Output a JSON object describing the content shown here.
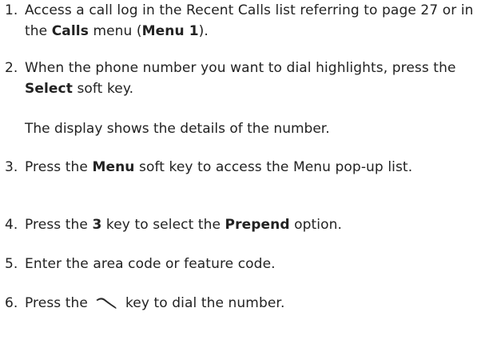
{
  "steps": [
    {
      "number": "1.",
      "parts": [
        {
          "text": "Access a call log in the Recent Calls list referring to page 27 or in the ",
          "bold": false
        },
        {
          "text": "Calls",
          "bold": true
        },
        {
          "text": " menu (",
          "bold": false
        },
        {
          "text": "Menu 1",
          "bold": true
        },
        {
          "text": ").",
          "bold": false
        }
      ]
    },
    {
      "number": "2.",
      "parts": [
        {
          "text": "When the phone number you want to dial highlights, press the ",
          "bold": false
        },
        {
          "text": "Select",
          "bold": true
        },
        {
          "text": " soft key.",
          "bold": false
        }
      ]
    },
    {
      "number": "3.",
      "parts": [
        {
          "text": "Press the ",
          "bold": false
        },
        {
          "text": "Menu",
          "bold": true
        },
        {
          "text": " soft key to access the Menu pop-up list.",
          "bold": false
        }
      ]
    },
    {
      "number": "4.",
      "parts": [
        {
          "text": "Press the ",
          "bold": false
        },
        {
          "text": "3",
          "bold": true
        },
        {
          "text": " key to select the ",
          "bold": false
        },
        {
          "text": "Prepend",
          "bold": true
        },
        {
          "text": " option.",
          "bold": false
        }
      ]
    },
    {
      "number": "5.",
      "parts": [
        {
          "text": "Enter the area code or feature code.",
          "bold": false
        }
      ]
    },
    {
      "number": "6.",
      "parts": [
        {
          "text": "Press the ",
          "bold": false
        },
        {
          "icon": "send-key-icon"
        },
        {
          "text": " key to dial the number.",
          "bold": false
        }
      ]
    }
  ],
  "note": "The display shows the details of the number.",
  "colors": {
    "text": "#222222",
    "background": "#ffffff"
  }
}
